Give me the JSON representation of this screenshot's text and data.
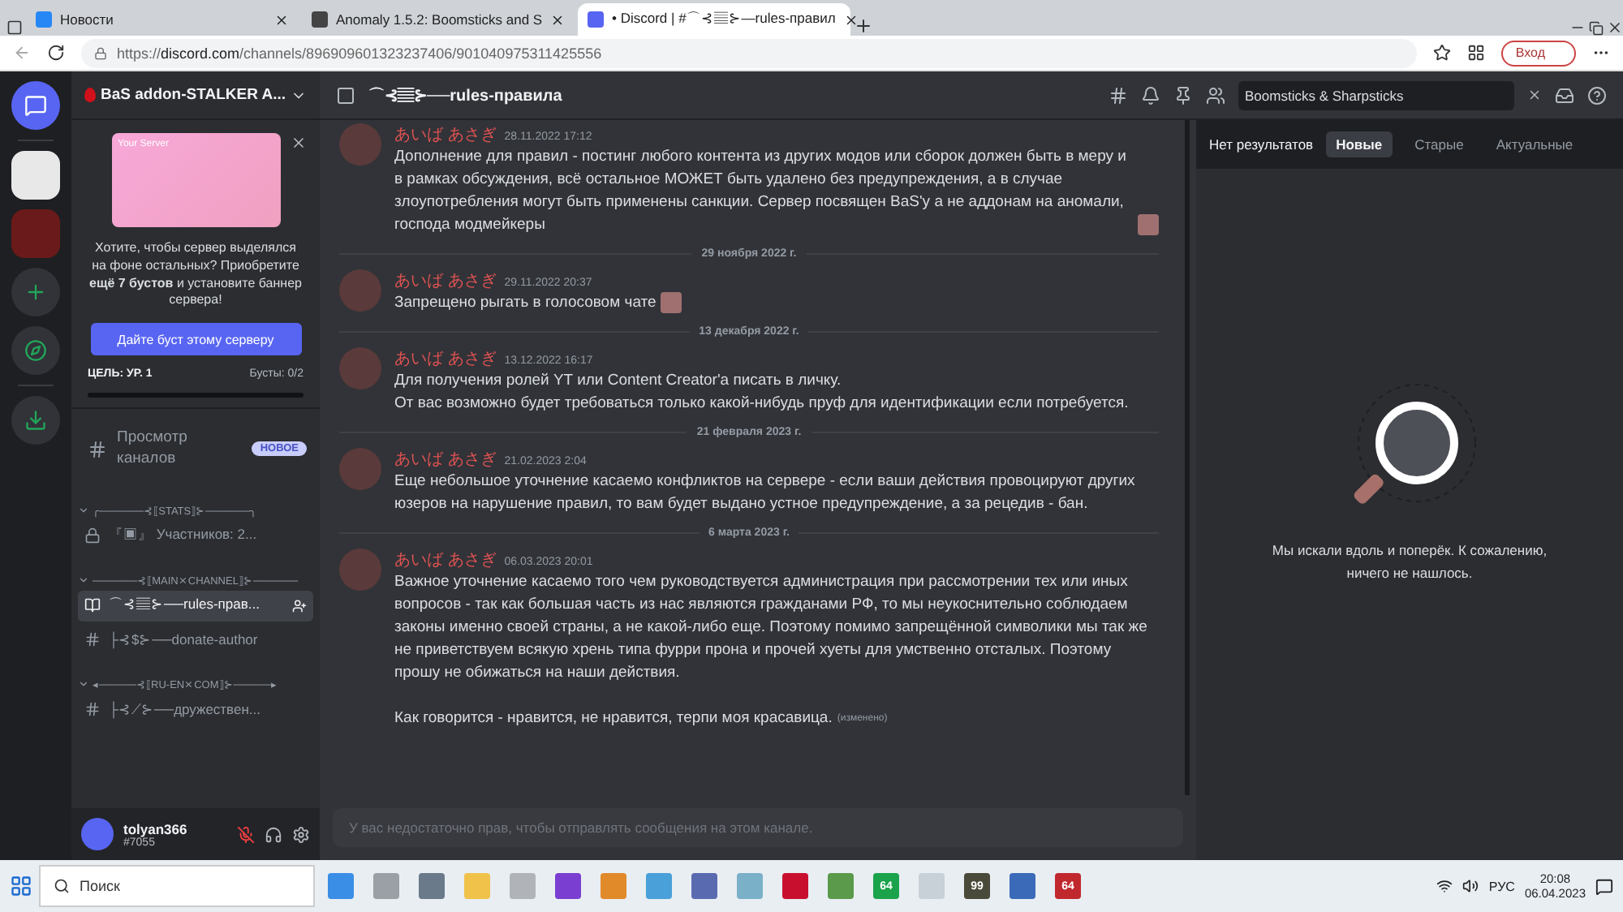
{
  "browser": {
    "tabs": [
      {
        "title": "Новости",
        "selected": false
      },
      {
        "title": "Anomaly 1.5.2: Boomsticks and S",
        "selected": false
      },
      {
        "title": "• Discord | #⌒⊰▤⊱—rules-правил",
        "selected": true
      }
    ],
    "url_prefix": "https://",
    "url_domain": "discord.com",
    "url_path": "/channels/896909601323237406/901040975311425556",
    "login": "Вход"
  },
  "sidebar": {
    "server_name": "BaS addon-STALKER A...",
    "boost": {
      "card_label": "Your Server",
      "text": "Хотите, чтобы сервер выделялся на фоне остальных? Приобретите **ещё 7 бустов** и установите баннер сервера!",
      "button": "Дайте буст этому серверу",
      "goal": "ЦЕЛЬ: УР. 1",
      "boosts": "Бусты: 0/2",
      "level": 0
    },
    "browse": {
      "label": "Просмотр каналов",
      "badge": "НОВОЕ"
    },
    "categories": [
      {
        "name": "╭──────⊰⟦STATS⟧⊱──────╮",
        "channels": [
          {
            "name": "『▣』 Участников: 2...",
            "kind": "locked",
            "selected": false
          }
        ]
      },
      {
        "name": "──────⊰⟦MAIN⨯CHANNEL⟧⊱──────",
        "channels": [
          {
            "name": "⌒⊰▤⊱──rules-прав...",
            "kind": "rules",
            "selected": true
          },
          {
            "name": "├⊰$⊱──donate-author",
            "kind": "text",
            "selected": false
          }
        ]
      },
      {
        "name": "◂─────⊰⟦RU-EN⨯COM⟧⊱─────▸",
        "channels": [
          {
            "name": "├⊰⟋⊱──дружествен...",
            "kind": "text",
            "selected": false
          }
        ]
      }
    ],
    "user": {
      "name": "tolyan366",
      "tag": "#7055"
    }
  },
  "chat": {
    "channel_name": "⌒⊰▤⊱──rules-правила",
    "items": [
      {
        "kind": "message",
        "author": "あいば あさぎ",
        "time": "28.11.2022 17:12",
        "paragraphs": [
          "Дополнение для правил - постинг любого контента из других модов или сборок должен быть в меру и в рамках обсуждения, всё остальное МОЖЕТ быть удалено без предупреждения, а в случае злоупотребления могут быть применены санкции. Сервер посвящен BaS'у а не аддонам на аномали, господа модмейкеры"
        ],
        "emoji": true
      },
      {
        "kind": "divider",
        "label": "29 ноября 2022 г."
      },
      {
        "kind": "message",
        "author": "あいば あさぎ",
        "time": "29.11.2022 20:37",
        "paragraphs": [
          "Запрещено рыгать в голосовом чате"
        ],
        "emoji": true
      },
      {
        "kind": "divider",
        "label": "13 декабря 2022 г."
      },
      {
        "kind": "message",
        "author": "あいば あさぎ",
        "time": "13.12.2022 16:17",
        "paragraphs": [
          "Для получения ролей YT или Content Creator'a писать в личку.",
          "От вас возможно будет требоваться только какой-нибудь пруф для идентификации если потребуется."
        ]
      },
      {
        "kind": "divider",
        "label": "21 февраля 2023 г."
      },
      {
        "kind": "message",
        "author": "あいば あさぎ",
        "time": "21.02.2023 2:04",
        "paragraphs": [
          "Еще небольшое уточнение касаемо конфликтов на сервере - если ваши действия провоцируют других юзеров на нарушение правил, то вам будет выдано устное предупреждение, а за рецедив - бан."
        ]
      },
      {
        "kind": "divider",
        "label": "6 марта 2023 г."
      },
      {
        "kind": "message",
        "author": "あいば あさぎ",
        "time": "06.03.2023 20:01",
        "paragraphs": [
          "Важное уточнение касаемо того чем руководствуется администрация при рассмотрении тех или иных вопросов - так как большая часть из нас являются гражданами РФ, то мы неукоснительно соблюдаем законы именно своей страны, а не какой-либо еще. Поэтому помимо запрещённой символики мы так же не приветствуем всякую хрень типа фурри прона и прочей хуеты для умственно отсталых. Поэтому прошу не обижаться на наши действия.",
          "Как говорится - нравится, не нравится, терпи моя красавица."
        ],
        "edited": "(изменено)"
      }
    ],
    "input_placeholder": "У вас недостаточно прав, чтобы отправлять сообщения на этом канале."
  },
  "search": {
    "value": "Boomsticks & Sharpsticks",
    "results": "Нет результатов",
    "sort_tabs": [
      {
        "label": "Новые",
        "selected": true
      },
      {
        "label": "Старые",
        "selected": false
      },
      {
        "label": "Актуальные",
        "selected": false
      }
    ],
    "empty_text": "Мы искали вдоль и поперёк. К сожалению, ничего не нашлось."
  },
  "taskbar": {
    "search": "Поиск",
    "apps": [
      {
        "color": "#3a8ee6"
      },
      {
        "color": "#9aa0a6"
      },
      {
        "color": "#6a7a8a"
      },
      {
        "color": "#f0c24a"
      },
      {
        "color": "#b0b4b8"
      },
      {
        "color": "#7a3fd0"
      },
      {
        "color": "#e08a2a"
      },
      {
        "color": "#4aa0d8"
      },
      {
        "color": "#5a6ab0"
      },
      {
        "color": "#7ab0c8"
      },
      {
        "color": "#c8102e"
      },
      {
        "color": "#5a9a4a"
      },
      {
        "color": "#1aa34a",
        "label": "64"
      },
      {
        "color": "#c8d0d8"
      },
      {
        "color": "#4a4a3a",
        "label": "99"
      },
      {
        "color": "#3a6ab8"
      },
      {
        "color": "#c0282e",
        "label": "64"
      }
    ],
    "lang": "РУС",
    "time": "20:08",
    "date": "06.04.2023"
  }
}
